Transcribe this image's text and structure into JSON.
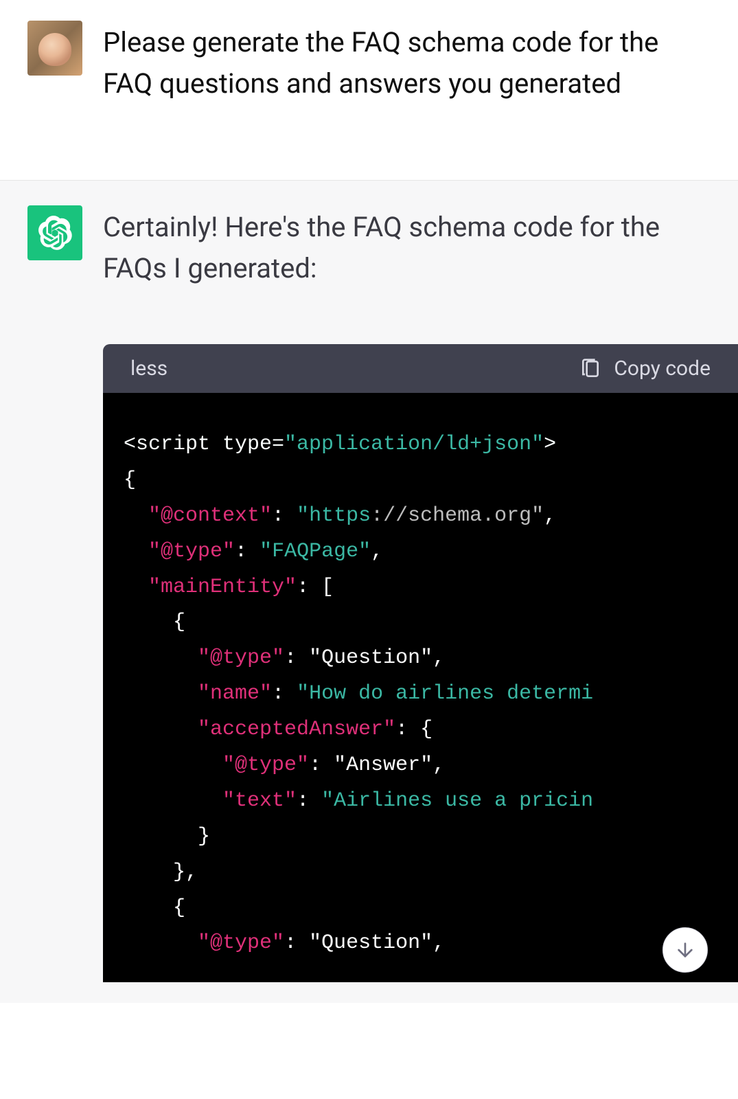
{
  "user_message": "Please generate the FAQ schema code for the FAQ questions and answers you generated",
  "assistant_message": "Certainly! Here's the FAQ schema code for the FAQs I generated:",
  "code_block": {
    "language": "less",
    "copy_label": "Copy code",
    "lines": {
      "script_open_1": "<script type=",
      "script_open_2": "\"application/ld+json\"",
      "script_open_3": ">",
      "brace_open": "{",
      "context_key": "\"@context\"",
      "context_val_proto": "\"https",
      "context_val_rest": "://schema.org\"",
      "type_key": "\"@type\"",
      "type_val": "\"FAQPage\"",
      "mainentity_key": "\"mainEntity\"",
      "q_type_key": "\"@type\"",
      "q_type_val": "\"Question\"",
      "q_name_key": "\"name\"",
      "q_name_val": "\"How do airlines determi",
      "q_accepted_key": "\"acceptedAnswer\"",
      "a_type_key": "\"@type\"",
      "a_type_val": "\"Answer\"",
      "a_text_key": "\"text\"",
      "a_text_val": "\"Airlines use a pricin",
      "q2_type_key": "\"@type\"",
      "q2_type_val": "\"Question\""
    }
  }
}
